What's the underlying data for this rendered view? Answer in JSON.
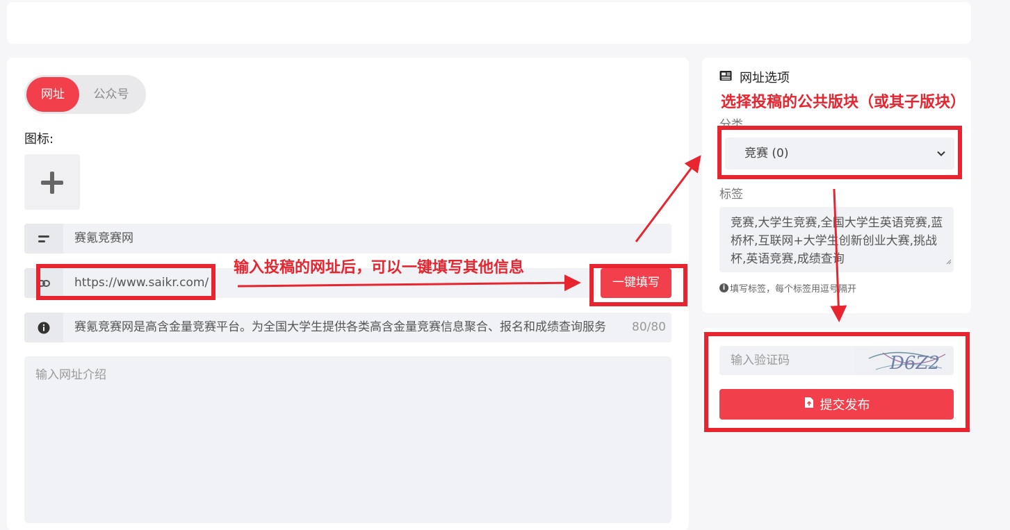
{
  "source_tabs": {
    "website": "网址",
    "official_account": "公众号",
    "active": "网址"
  },
  "icon_field": {
    "label": "图标:"
  },
  "name_field": {
    "value": "赛氪竞赛网"
  },
  "url_field": {
    "value": "https://www.saikr.com/"
  },
  "autofill_button": {
    "label": "一键填写"
  },
  "description_field": {
    "value": "赛氪竞赛网是高含金量竞赛平台。为全国大学生提供各类高含金量竞赛信息聚合、报名和成绩查询服务",
    "counter": "80/80"
  },
  "intro_field": {
    "placeholder": "输入网址介绍"
  },
  "options_panel": {
    "title": "网址选项",
    "category_label": "分类",
    "category_value": "竞赛 (0)",
    "tags_label": "标签",
    "tags_value": "竞赛,大学生竞赛,全国大学生英语竞赛,蓝桥杯,互联网+大学生创新创业大赛,挑战杯,英语竞赛,成绩查询",
    "tags_hint": "填写标签，每个标签用逗号隔开"
  },
  "verify_panel": {
    "captcha_placeholder": "输入验证码",
    "captcha_text": "D6Z2",
    "submit_label": "提交发布"
  },
  "annotations": {
    "url_hint": "输入投稿的网址后，可以一键填写其他信息",
    "category_hint": "选择投稿的公共版块（或其子版块）"
  },
  "colors": {
    "accent": "#f1404b",
    "annotation_red": "#e8242f",
    "field_bg": "#f1f2f5"
  },
  "icons": {
    "name_prefix": "text-lines-icon",
    "url_prefix": "link-icon",
    "description_prefix": "info-icon",
    "upload": "plus-icon",
    "title": "newspaper-icon",
    "select": "chevron-down-icon",
    "submit": "file-upload-icon"
  }
}
